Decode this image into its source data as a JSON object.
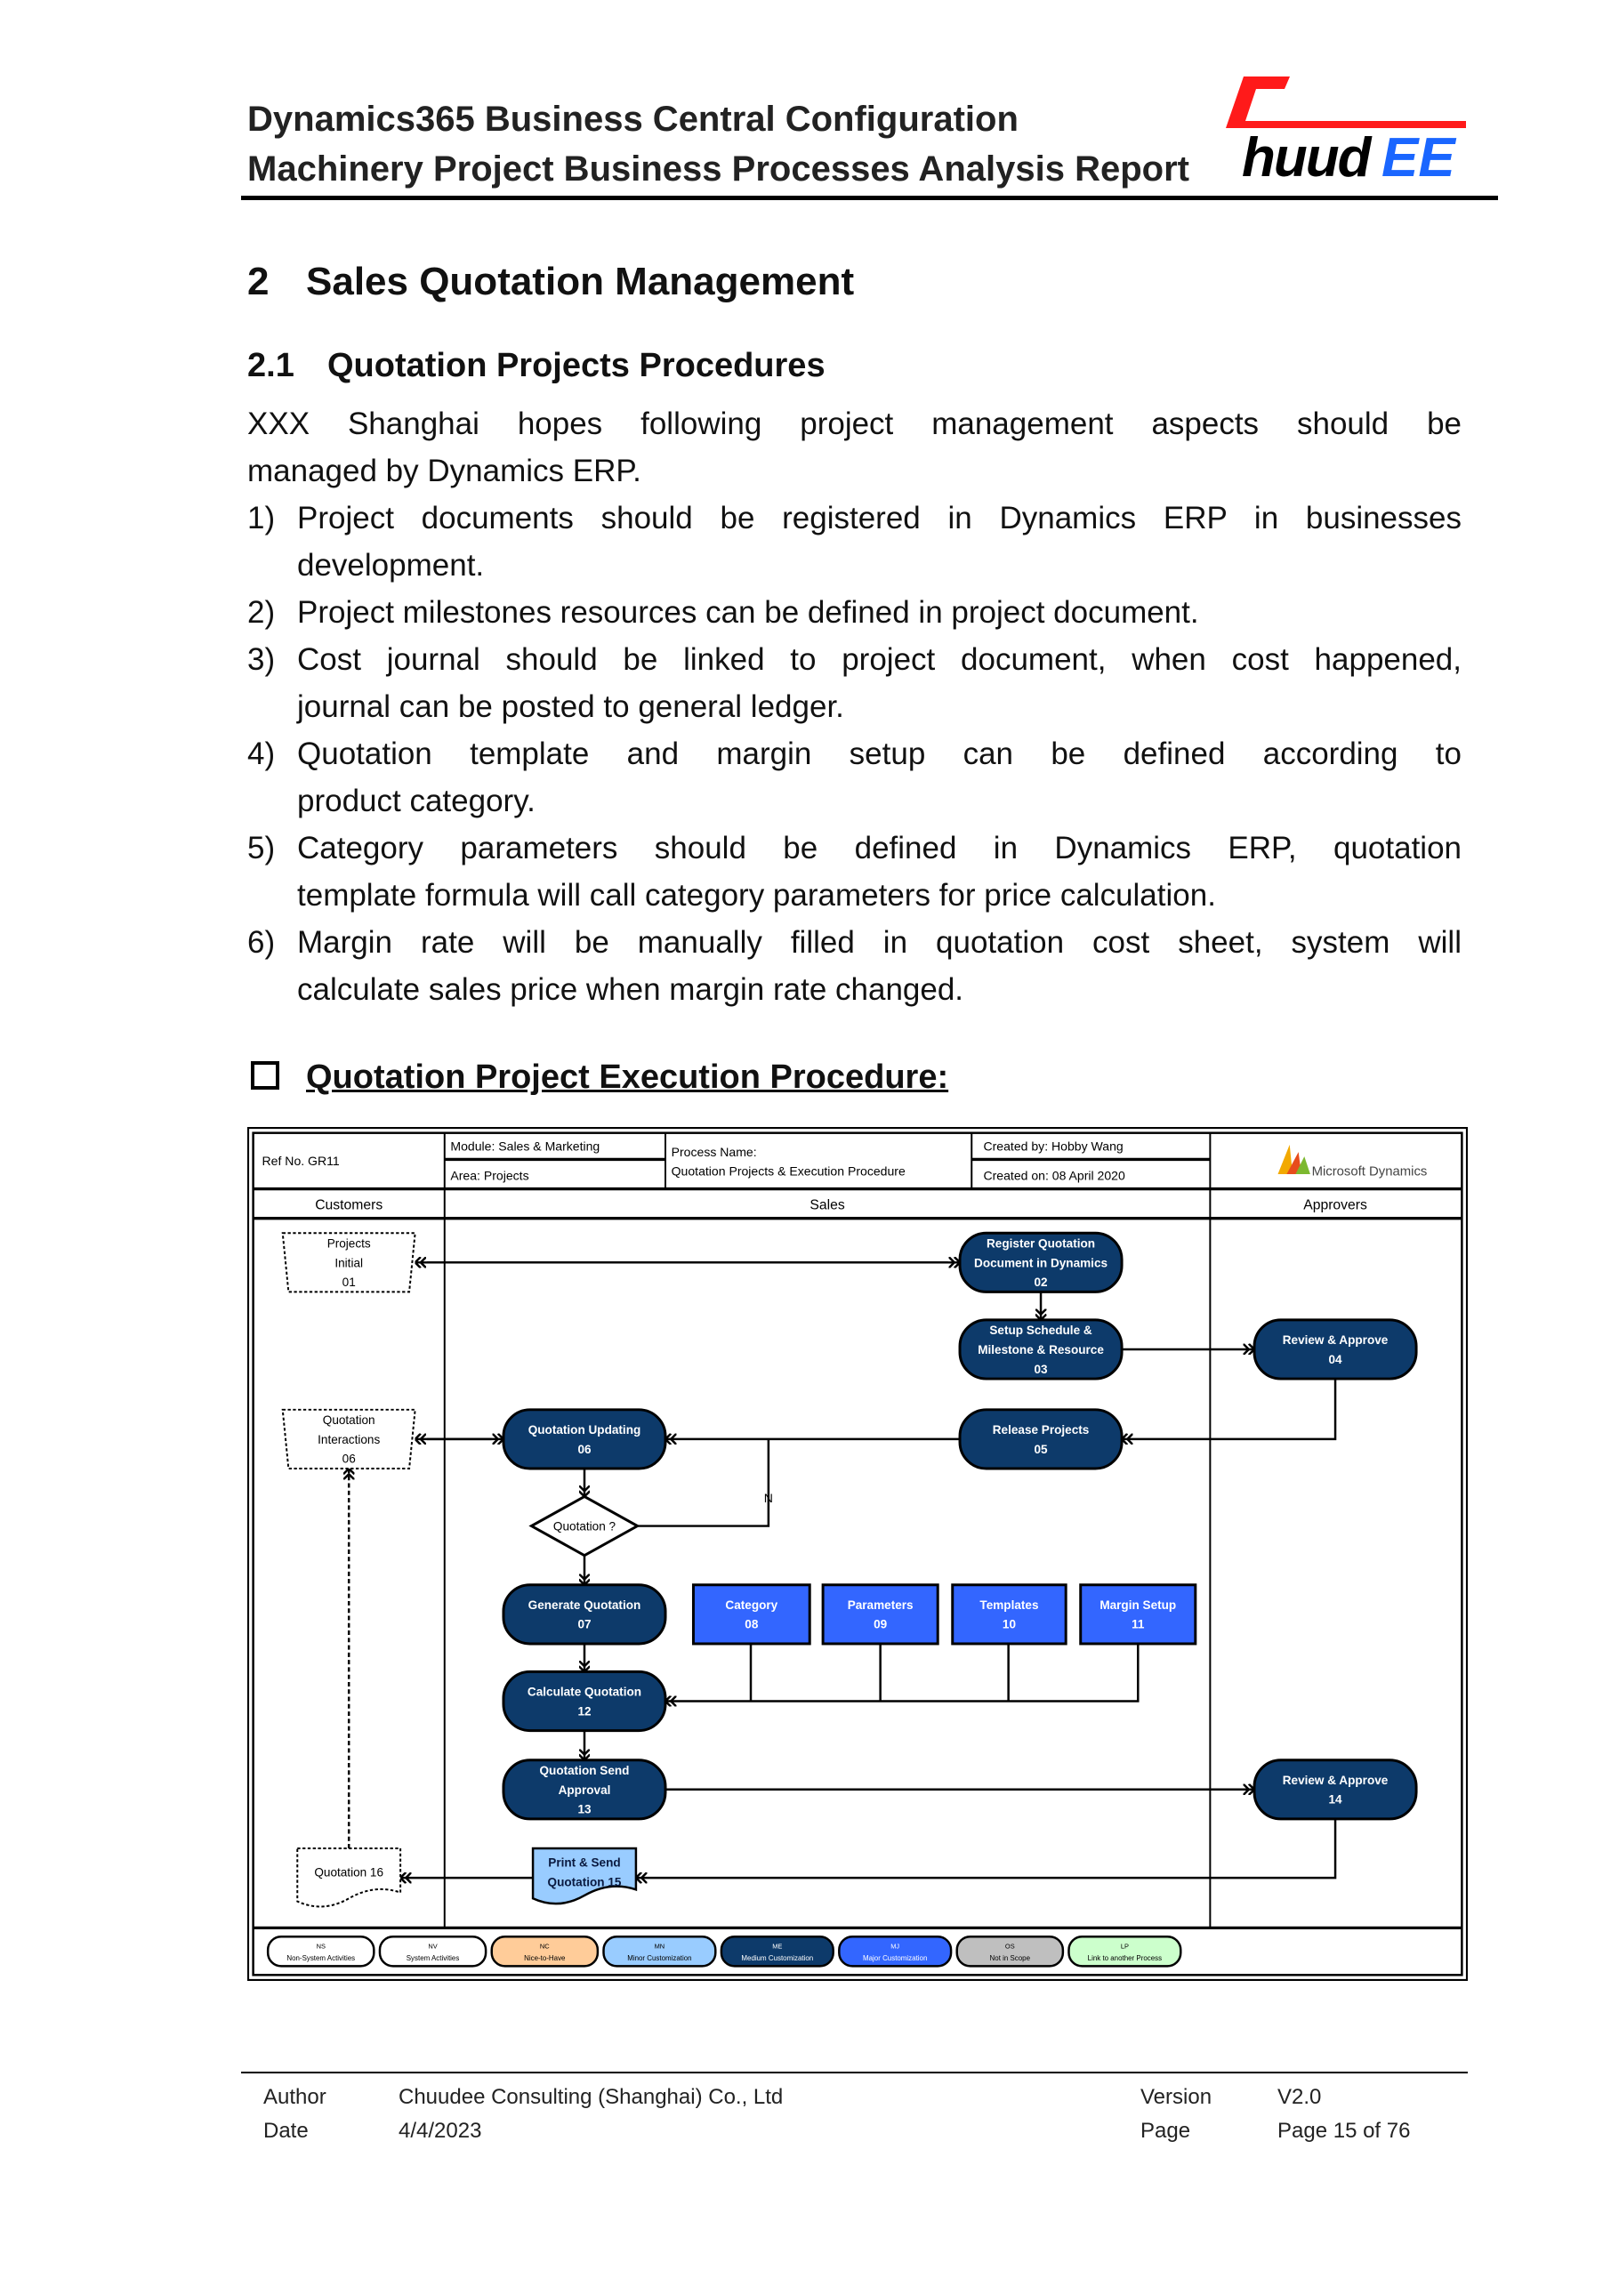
{
  "header": {
    "title_line1": "Dynamics365 Business Central Configuration",
    "title_line2": "Machinery Project Business Processes Analysis Report",
    "logo_text": "ChuudEE",
    "logo_colors": {
      "red": "#ff1a1a",
      "black": "#000000",
      "blue": "#1a66ff"
    }
  },
  "section": {
    "number": "2",
    "title": "Sales Quotation Management"
  },
  "subsection": {
    "number": "2.1",
    "title": "Quotation Projects Procedures"
  },
  "intro": {
    "lines": [
      "XXX Shanghai hopes following project management aspects should be",
      "managed by Dynamics ERP."
    ]
  },
  "items": [
    {
      "n": "1)",
      "lines": [
        "Project documents should be registered in Dynamics ERP in businesses",
        "development."
      ]
    },
    {
      "n": "2)",
      "lines": [
        "Project milestones resources can be defined in project document."
      ]
    },
    {
      "n": "3)",
      "lines": [
        "Cost journal should be linked to project document, when cost happened,",
        "journal can be posted to general ledger."
      ]
    },
    {
      "n": "4)",
      "lines": [
        "Quotation template and margin setup can be defined according to",
        "product category."
      ]
    },
    {
      "n": "5)",
      "lines": [
        "Category parameters should be defined in Dynamics ERP, quotation",
        "template formula will call category parameters for price calculation."
      ]
    },
    {
      "n": "6)",
      "lines": [
        "Margin rate will be manually filled in quotation cost sheet, system will",
        "calculate sales price when margin rate changed."
      ]
    }
  ],
  "procedure_heading": {
    "checkbox_checked": false,
    "title": "Quotation Project Execution Procedure:"
  },
  "diagram": {
    "ref_no": "Ref No.  GR11",
    "module": "Module: Sales & Marketing",
    "area": "Area:  Projects",
    "process_name_label": "Process Name:",
    "process_name": "Quotation Projects & Execution Procedure",
    "created_by": "Created by: Hobby Wang",
    "created_on": "Created on: 08 April 2020",
    "brand_logo": "Microsoft Dynamics",
    "lanes": [
      "Customers",
      "Sales",
      "Approvers"
    ],
    "colors": {
      "process": "#0d3a6a",
      "major": "#3366ff",
      "minor": "#99ccff",
      "nice": "#ffcc99",
      "scope": "#bfbfbf",
      "link": "#ccffcc"
    },
    "nodes": {
      "n01": [
        "Projects",
        "Initial",
        "01"
      ],
      "n02": [
        "Register Quotation",
        "Document in Dynamics",
        "02"
      ],
      "n03": [
        "Setup Schedule &",
        "Milestone & Resource",
        "03"
      ],
      "n04": [
        "Review & Approve",
        "04"
      ],
      "n05": [
        "Release Projects",
        "05"
      ],
      "n06": [
        "Quotation Updating",
        "06"
      ],
      "c06": [
        "Quotation",
        "Interactions",
        "06"
      ],
      "dq": [
        "Quotation ?"
      ],
      "n07": [
        "Generate Quotation",
        "07"
      ],
      "n08": [
        "Category",
        "08"
      ],
      "n09": [
        "Parameters",
        "09"
      ],
      "n10": [
        "Templates",
        "10"
      ],
      "n11": [
        "Margin Setup",
        "11"
      ],
      "n12": [
        "Calculate Quotation",
        "12"
      ],
      "n13": [
        "Quotation Send",
        "Approval",
        "13"
      ],
      "n14": [
        "Review & Approve",
        "14"
      ],
      "n15": [
        "Print & Send",
        "Quotation 15"
      ],
      "c16": [
        "Quotation 16"
      ]
    },
    "branch_label": "N",
    "legend": [
      {
        "code": "NS",
        "label": "Non-System Activities",
        "color": "#ffffff"
      },
      {
        "code": "NV",
        "label": "System Activities",
        "color": "#ffffff"
      },
      {
        "code": "NC",
        "label": "Nice-to-Have",
        "color": "#ffcc99"
      },
      {
        "code": "MN",
        "label": "Minor Customization",
        "color": "#99ccff"
      },
      {
        "code": "ME",
        "label": "Medium Customization",
        "color": "#0d3a6a"
      },
      {
        "code": "MJ",
        "label": "Major Customization",
        "color": "#3366ff"
      },
      {
        "code": "OS",
        "label": "Not in Scope",
        "color": "#bfbfbf"
      },
      {
        "code": "LP",
        "label": "Link to another Process",
        "color": "#ccffcc"
      }
    ]
  },
  "footer": {
    "author_label": "Author",
    "author": "Chuudee Consulting (Shanghai) Co., Ltd",
    "date_label": "Date",
    "date": "4/4/2023",
    "version_label": "Version",
    "version": "V2.0",
    "page_label": "Page",
    "page": "Page 15 of 76"
  }
}
